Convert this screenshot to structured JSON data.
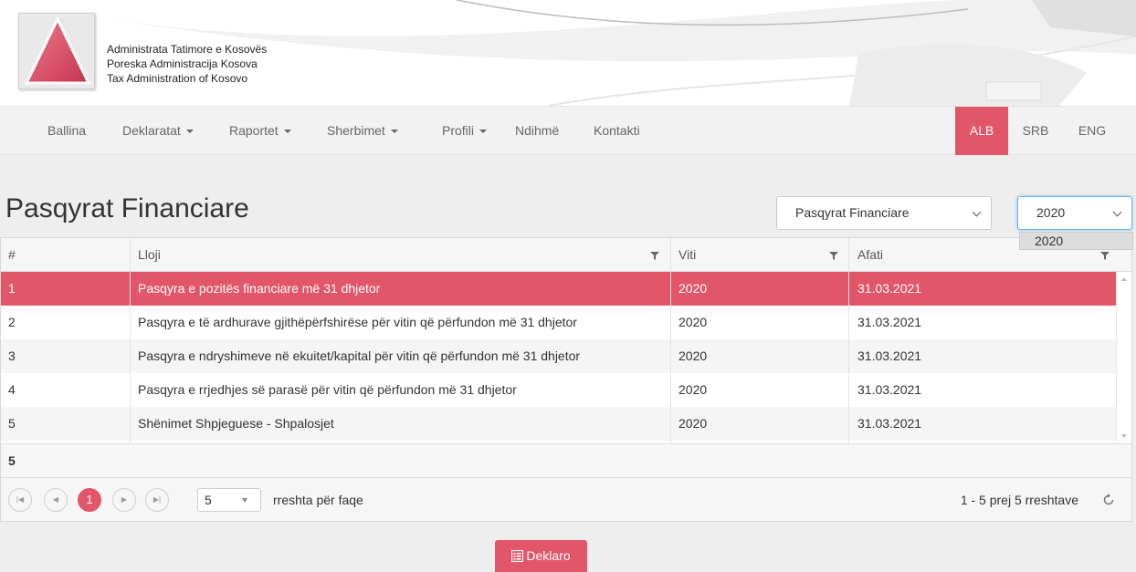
{
  "colors": {
    "accent": "#e25669",
    "navbar_bg": "#f2f2f2",
    "page_bg": "#eeeeee"
  },
  "header": {
    "org_lines": [
      "Administrata Tatimore e Kosovës",
      "Poreska Administracija Kosova",
      "Tax Administration of Kosovo"
    ]
  },
  "nav": {
    "items": [
      "Ballina",
      "Deklaratat",
      "Raportet",
      "Sherbimet",
      "Profili",
      "Ndihmë",
      "Kontakti"
    ],
    "languages": [
      "ALB",
      "SRB",
      "ENG"
    ],
    "active_language": "ALB"
  },
  "page": {
    "title": "Pasqyrat Financiare",
    "type_select": {
      "value": "Pasqyrat Financiare",
      "icon": "chevron-down-icon"
    },
    "year_select": {
      "value": "2020",
      "options": [
        "2020"
      ],
      "icon": "chevron-down-icon"
    }
  },
  "grid": {
    "columns": [
      "#",
      "Lloji",
      "Viti",
      "Afati"
    ],
    "rows": [
      {
        "num": "1",
        "lloji": "Pasqyra e pozitës financiare më 31 dhjetor",
        "viti": "2020",
        "afati": "31.03.2021"
      },
      {
        "num": "2",
        "lloji": "Pasqyra e të ardhurave gjithëpërfshirëse për vitin që përfundon më 31 dhjetor",
        "viti": "2020",
        "afati": "31.03.2021"
      },
      {
        "num": "3",
        "lloji": "Pasqyra e ndryshimeve në ekuitet/kapital për vitin që përfundon më 31 dhjetor",
        "viti": "2020",
        "afati": "31.03.2021"
      },
      {
        "num": "4",
        "lloji": "Pasqyra e rrjedhjes së parasë për vitin që përfundon më 31 dhjetor",
        "viti": "2020",
        "afati": "31.03.2021"
      },
      {
        "num": "5",
        "lloji": "Shënimet Shpjeguese - Shpalosjet",
        "viti": "2020",
        "afati": "31.03.2021"
      }
    ],
    "selected_row": 1,
    "footer_count": "5"
  },
  "pager": {
    "current_page": "1",
    "page_size": "5",
    "page_size_label": "rreshta për faqe",
    "info": "1 - 5 prej 5 rreshtave"
  },
  "actions": {
    "deklaro_label": "Deklaro",
    "deklaro_icon": "list-icon"
  }
}
